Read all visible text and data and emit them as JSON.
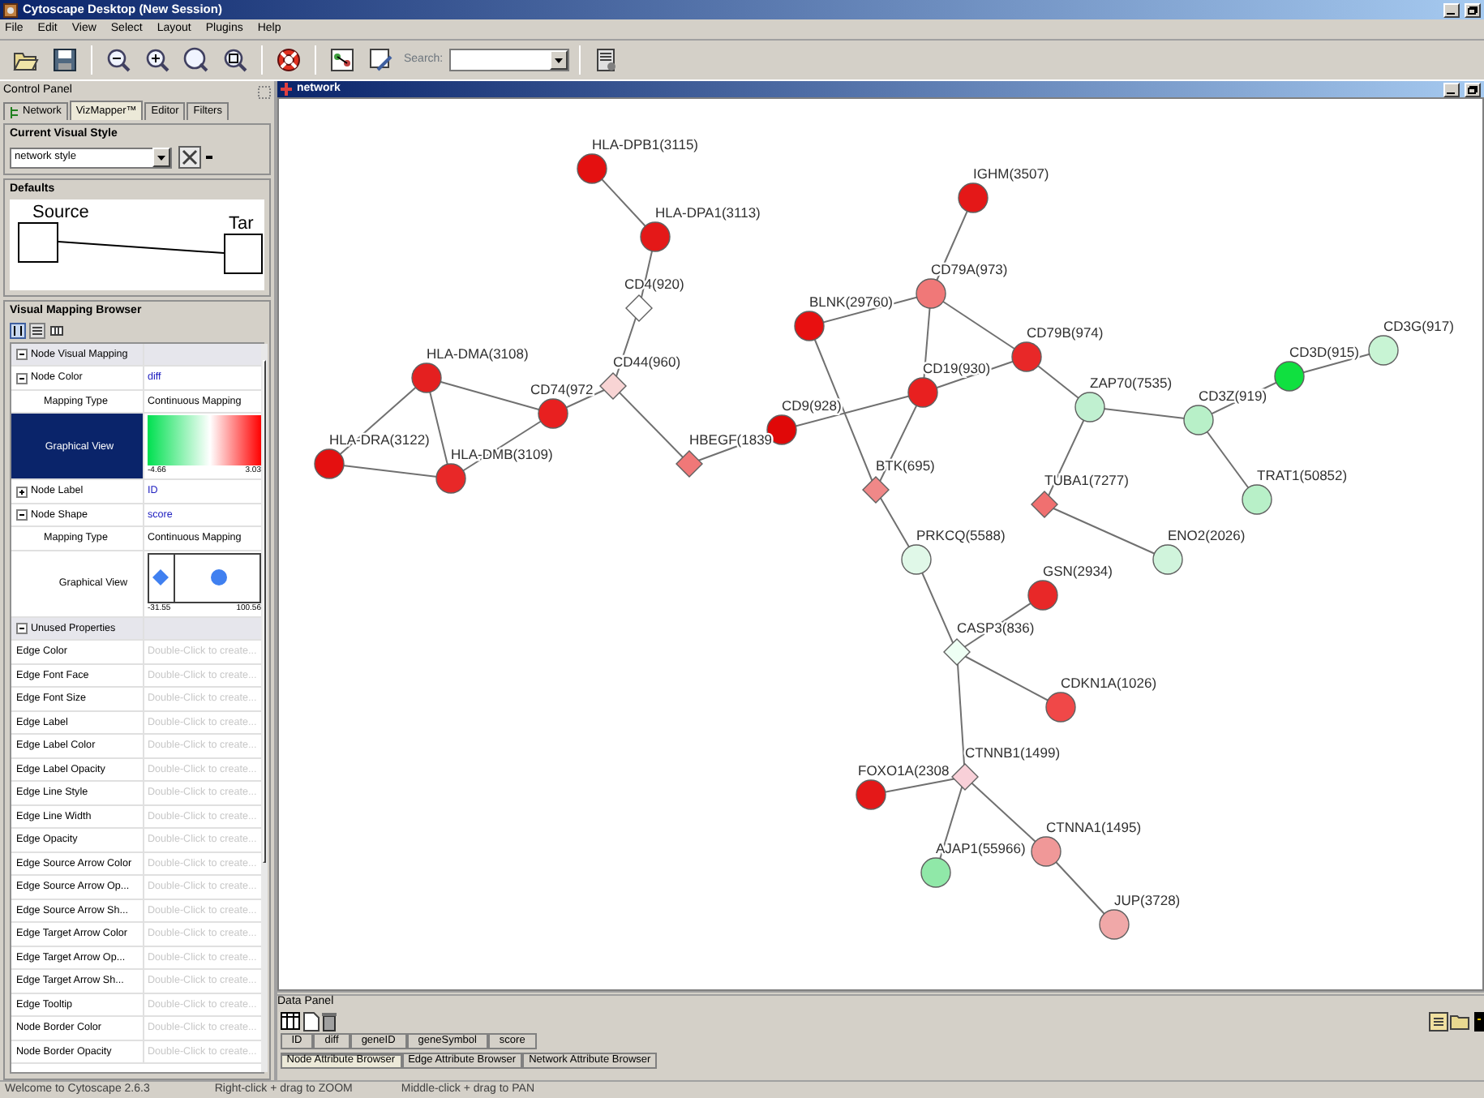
{
  "window": {
    "title": "Cytoscape Desktop (New Session)"
  },
  "menu": [
    "File",
    "Edit",
    "View",
    "Select",
    "Layout",
    "Plugins",
    "Help"
  ],
  "toolbar": {
    "search_label": "Search:"
  },
  "control_panel": {
    "title": "Control Panel",
    "tabs": [
      {
        "label": "Network",
        "selected": false
      },
      {
        "label": "VizMapper™",
        "selected": true
      },
      {
        "label": "Editor",
        "selected": false
      },
      {
        "label": "Filters",
        "selected": false
      }
    ],
    "visual_style": {
      "title": "Current Visual Style",
      "value": "network style"
    },
    "defaults": {
      "title": "Defaults",
      "source": "Source",
      "target": "Tar"
    },
    "mapping_browser": {
      "title": "Visual Mapping Browser",
      "rows": [
        {
          "kind": "section",
          "label": "Node Visual Mapping",
          "expanded": true,
          "selected": false
        },
        {
          "kind": "property",
          "label": "Node Color",
          "value": "diff",
          "expanded": true,
          "selected": false
        },
        {
          "kind": "sub",
          "label": "Mapping Type",
          "value": "Continuous Mapping",
          "selected": false
        },
        {
          "kind": "gradient",
          "label": "Graphical View",
          "min": "-4.66",
          "max": "3.03",
          "selected": true
        },
        {
          "kind": "property",
          "label": "Node Label",
          "value": "ID",
          "expanded": false,
          "selected": false
        },
        {
          "kind": "property",
          "label": "Node Shape",
          "value": "score",
          "expanded": true,
          "selected": false
        },
        {
          "kind": "sub",
          "label": "Mapping Type",
          "value": "Continuous Mapping",
          "selected": false
        },
        {
          "kind": "shapes",
          "label": "Graphical View",
          "min": "-31.55",
          "max": "100.56",
          "selected": false
        },
        {
          "kind": "section",
          "label": "Unused Properties",
          "expanded": true,
          "selected": false
        },
        {
          "kind": "unused",
          "label": "Edge Color",
          "value": "Double-Click to create...",
          "selected": false
        },
        {
          "kind": "unused",
          "label": "Edge Font Face",
          "value": "Double-Click to create...",
          "selected": false
        },
        {
          "kind": "unused",
          "label": "Edge Font Size",
          "value": "Double-Click to create...",
          "selected": false
        },
        {
          "kind": "unused",
          "label": "Edge Label",
          "value": "Double-Click to create...",
          "selected": false
        },
        {
          "kind": "unused",
          "label": "Edge Label Color",
          "value": "Double-Click to create...",
          "selected": false
        },
        {
          "kind": "unused",
          "label": "Edge Label Opacity",
          "value": "Double-Click to create...",
          "selected": false
        },
        {
          "kind": "unused",
          "label": "Edge Line Style",
          "value": "Double-Click to create...",
          "selected": false
        },
        {
          "kind": "unused",
          "label": "Edge Line Width",
          "value": "Double-Click to create...",
          "selected": false
        },
        {
          "kind": "unused",
          "label": "Edge Opacity",
          "value": "Double-Click to create...",
          "selected": false
        },
        {
          "kind": "unused",
          "label": "Edge Source Arrow Color",
          "value": "Double-Click to create...",
          "selected": false
        },
        {
          "kind": "unused",
          "label": "Edge Source Arrow Op...",
          "value": "Double-Click to create...",
          "selected": false
        },
        {
          "kind": "unused",
          "label": "Edge Source Arrow Sh...",
          "value": "Double-Click to create...",
          "selected": false
        },
        {
          "kind": "unused",
          "label": "Edge Target Arrow Color",
          "value": "Double-Click to create...",
          "selected": false
        },
        {
          "kind": "unused",
          "label": "Edge Target Arrow Op...",
          "value": "Double-Click to create...",
          "selected": false
        },
        {
          "kind": "unused",
          "label": "Edge Target Arrow Sh...",
          "value": "Double-Click to create...",
          "selected": false
        },
        {
          "kind": "unused",
          "label": "Edge Tooltip",
          "value": "Double-Click to create...",
          "selected": false
        },
        {
          "kind": "unused",
          "label": "Node Border Color",
          "value": "Double-Click to create...",
          "selected": false
        },
        {
          "kind": "unused",
          "label": "Node Border Opacity",
          "value": "Double-Click to create...",
          "selected": false
        }
      ]
    }
  },
  "network": {
    "title": "network",
    "nodes": [
      {
        "label": "HLA-DPB1(3115)",
        "kind": "circle",
        "color": "#e41010"
      },
      {
        "label": "HLA-DPA1(3113)",
        "kind": "circle",
        "color": "#e41818"
      },
      {
        "label": "CD4(920)",
        "kind": "diamond",
        "color": "#ffffff"
      },
      {
        "label": "CD44(960)",
        "kind": "diamond",
        "color": "#f8d4d4"
      },
      {
        "label": "CD74(972",
        "kind": "circle",
        "color": "#e82020"
      },
      {
        "label": "HLA-DMA(3108)",
        "kind": "circle",
        "color": "#e42020"
      },
      {
        "label": "HLA-DRA(3122)",
        "kind": "circle",
        "color": "#e41010"
      },
      {
        "label": "HLA-DMB(3109)",
        "kind": "circle",
        "color": "#e82828"
      },
      {
        "label": "HBEGF(1839",
        "kind": "diamond",
        "color": "#f07878"
      },
      {
        "label": "IGHM(3507)",
        "kind": "circle",
        "color": "#e41818"
      },
      {
        "label": "CD79A(973)",
        "kind": "circle",
        "color": "#f07878"
      },
      {
        "label": "BLNK(29760)",
        "kind": "circle",
        "color": "#e81010"
      },
      {
        "label": "CD19(930)",
        "kind": "circle",
        "color": "#e82020"
      },
      {
        "label": "CD79B(974)",
        "kind": "circle",
        "color": "#e82828"
      },
      {
        "label": "CD9(928)",
        "kind": "circle",
        "color": "#e00808"
      },
      {
        "label": "BTK(695)",
        "kind": "diamond",
        "color": "#f08888"
      },
      {
        "label": "ZAP70(7535)",
        "kind": "circle",
        "color": "#c0f0d0"
      },
      {
        "label": "CD3Z(919)",
        "kind": "circle",
        "color": "#b8f0c8"
      },
      {
        "label": "CD3D(915)",
        "kind": "circle",
        "color": "#10e040"
      },
      {
        "label": "CD3G(917)",
        "kind": "circle",
        "color": "#c8f4d4"
      },
      {
        "label": "TUBA1(7277)",
        "kind": "diamond",
        "color": "#f07070"
      },
      {
        "label": "TRAT1(50852)",
        "kind": "circle",
        "color": "#b8f0c8"
      },
      {
        "label": "ENO2(2026)",
        "kind": "circle",
        "color": "#d0f4dc"
      },
      {
        "label": "PRKCQ(5588)",
        "kind": "circle",
        "color": "#e0f8e8"
      },
      {
        "label": "GSN(2934)",
        "kind": "circle",
        "color": "#e82828"
      },
      {
        "label": "CASP3(836)",
        "kind": "diamond",
        "color": "#eefff4"
      },
      {
        "label": "CDKN1A(1026)",
        "kind": "circle",
        "color": "#f04848"
      },
      {
        "label": "CTNNB1(1499)",
        "kind": "diamond",
        "color": "#f8d0d8"
      },
      {
        "label": "FOXO1A(2308",
        "kind": "circle",
        "color": "#e41818"
      },
      {
        "label": "CTNNA1(1495)",
        "kind": "circle",
        "color": "#f09898"
      },
      {
        "label": "AJAP1(55966)",
        "kind": "circle",
        "color": "#90e8a8"
      },
      {
        "label": "JUP(3728)",
        "kind": "circle",
        "color": "#f0a8a8"
      }
    ]
  },
  "data_panel": {
    "title": "Data Panel",
    "columns": [
      "ID",
      "diff",
      "geneID",
      "geneSymbol",
      "score"
    ],
    "tabs": [
      {
        "label": "Node Attribute Browser",
        "selected": true
      },
      {
        "label": "Edge Attribute Browser",
        "selected": false
      },
      {
        "label": "Network Attribute Browser",
        "selected": false
      }
    ]
  },
  "status_bar": [
    "Welcome to Cytoscape 2.6.3",
    "Right-click + drag to  ZOOM",
    "Middle-click + drag to  PAN"
  ]
}
